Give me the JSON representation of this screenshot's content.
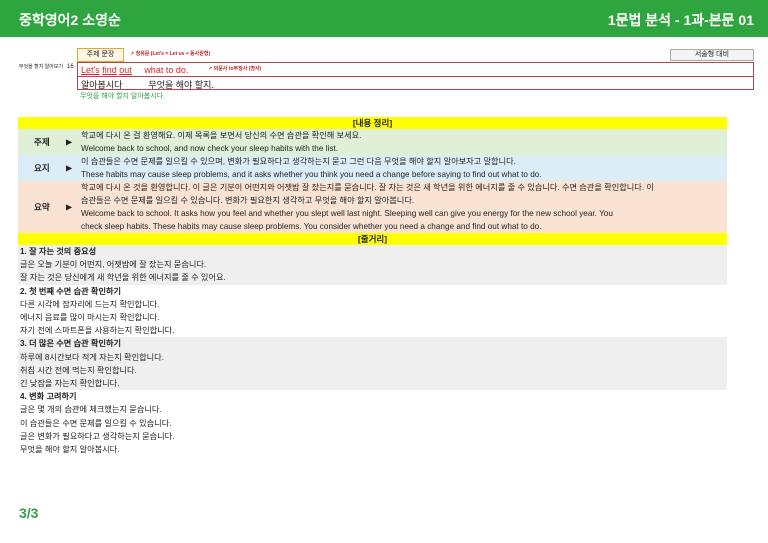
{
  "header": {
    "left": "중학영어2 소영순",
    "right": "1문법 분석 - 1과-본문 01"
  },
  "grammar": {
    "label": "무엇을 할지 알아보기",
    "number": "16",
    "theme": "주제 문장",
    "note1": "청유문 (Let's = Let us + 동사원형)",
    "essay": "서술형 대비",
    "en_words": [
      "Let's",
      "find",
      "out",
      "what to do."
    ],
    "note2": "의문사 to부정사 (명사)",
    "ko": [
      "알아봅시다",
      "무엇을 해야 할지."
    ],
    "green": "무엇을 해야 할지 알아봅시다."
  },
  "summary": {
    "title": "[내용 정리]",
    "rows": [
      {
        "tag": "주제",
        "lines": [
          "학교에 다시 온 걸 환영해요. 이제 목록을 보면서 당신의 수면 습관을 확인해 보세요.",
          "Welcome back to school, and now check your sleep habits with the list."
        ]
      },
      {
        "tag": "요지",
        "lines": [
          "이 습관들은 수면 문제를 일으킬 수 있으며, 변화가 필요하다고 생각하는지 묻고 그런 다음 무엇을 해야 할지 알아보자고 말합니다.",
          "These habits may cause sleep problems, and it asks whether you think you need a change before saying to find out what to do."
        ]
      },
      {
        "tag": "요약",
        "lines": [
          "학교에 다시 온 것을 환영합니다. 이 글은 기분이 어떤지와 어젯밤 잘 잤는지를 묻습니다. 잘 자는 것은 새 학년을 위한 에너지를 줄 수 있습니다. 수면 습관을 확인합니다. 이",
          "습관들은 수면 문제를 일으킬 수 있습니다. 변화가 필요한지 생각하고 무엇을 해야 할지 알아봅니다.",
          "Welcome back to school. It asks how you feel and whether you slept well last night. Sleeping well can give you energy for the new school year. You",
          "check sleep habits. These habits may cause sleep problems. You consider whether you need a change and find out what to do."
        ]
      }
    ]
  },
  "outline": {
    "title": "[줄거리]",
    "sections": [
      {
        "title": "1. 잘 자는 것의 중요성",
        "lines": [
          "글은 오늘 기분이 어떤지, 어젯밤에 잘 잤는지 묻습니다.",
          "잘 자는 것은 당신에게 새 학년을 위한 에너지를 줄 수 있어요."
        ]
      },
      {
        "title": "2. 첫 번째 수면 습관 확인하기",
        "lines": [
          "다른 시각에 잠자리에 드는지 확인합니다.",
          "에너지 음료를 많이 마시는지 확인합니다.",
          "자기 전에 스마트폰을 사용하는지 확인합니다."
        ]
      },
      {
        "title": "3. 더 많은 수면 습관 확인하기",
        "lines": [
          "하루에 8시간보다 적게 자는지 확인합니다.",
          "취침 시간 전에 먹는지 확인합니다.",
          "긴 낮잠을 자는지 확인합니다."
        ]
      },
      {
        "title": "4. 변화 고려하기",
        "lines": [
          "글은 몇 개의 습관에 체크했는지 묻습니다.",
          "이 습관들은 수면 문제를 일으킬 수 있습니다.",
          "글은 변화가 필요하다고 생각하는지 묻습니다.",
          "무엇을 해야 할지 알아봅시다."
        ]
      }
    ]
  },
  "page": "3/3"
}
